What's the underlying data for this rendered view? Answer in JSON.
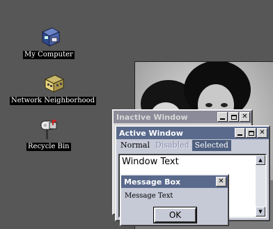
{
  "desktop": {
    "icons": [
      {
        "label": "My Computer",
        "icon": "computer-icon"
      },
      {
        "label": "Network Neighborhood",
        "icon": "network-icon"
      },
      {
        "label": "Recycle Bin",
        "icon": "recycle-bin-icon"
      }
    ]
  },
  "inactive_window": {
    "title": "Inactive Window"
  },
  "active_window": {
    "title": "Active Window",
    "menu": {
      "normal": "Normal",
      "disabled": "Disabled",
      "selected": "Selected"
    },
    "content": "Window Text"
  },
  "message_box": {
    "title": "Message Box",
    "text": "Message Text",
    "ok_label": "OK"
  },
  "colors": {
    "desktop": "#575757",
    "active_title": "#5a6a8c",
    "inactive_title": "#8b8b99",
    "selection": "#4e5f7f",
    "window_face": "#c6c9d6"
  }
}
